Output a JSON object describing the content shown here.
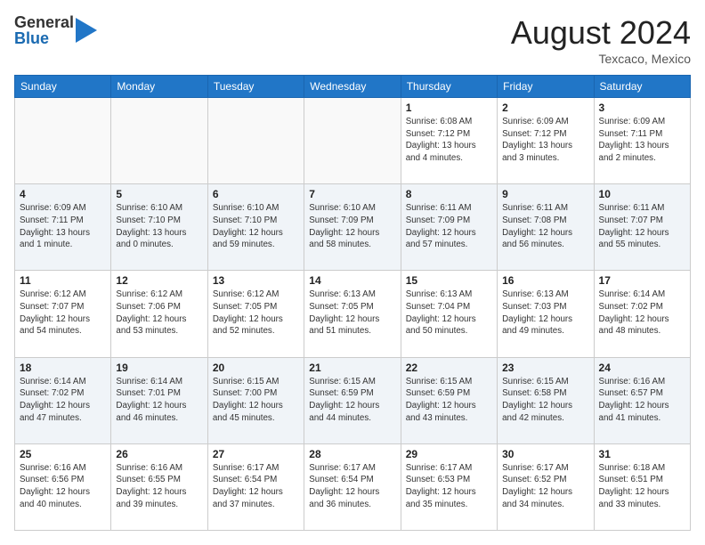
{
  "header": {
    "logo_general": "General",
    "logo_blue": "Blue",
    "month_year": "August 2024",
    "location": "Texcaco, Mexico"
  },
  "weekdays": [
    "Sunday",
    "Monday",
    "Tuesday",
    "Wednesday",
    "Thursday",
    "Friday",
    "Saturday"
  ],
  "weeks": [
    [
      {
        "day": "",
        "info": ""
      },
      {
        "day": "",
        "info": ""
      },
      {
        "day": "",
        "info": ""
      },
      {
        "day": "",
        "info": ""
      },
      {
        "day": "1",
        "info": "Sunrise: 6:08 AM\nSunset: 7:12 PM\nDaylight: 13 hours\nand 4 minutes."
      },
      {
        "day": "2",
        "info": "Sunrise: 6:09 AM\nSunset: 7:12 PM\nDaylight: 13 hours\nand 3 minutes."
      },
      {
        "day": "3",
        "info": "Sunrise: 6:09 AM\nSunset: 7:11 PM\nDaylight: 13 hours\nand 2 minutes."
      }
    ],
    [
      {
        "day": "4",
        "info": "Sunrise: 6:09 AM\nSunset: 7:11 PM\nDaylight: 13 hours\nand 1 minute."
      },
      {
        "day": "5",
        "info": "Sunrise: 6:10 AM\nSunset: 7:10 PM\nDaylight: 13 hours\nand 0 minutes."
      },
      {
        "day": "6",
        "info": "Sunrise: 6:10 AM\nSunset: 7:10 PM\nDaylight: 12 hours\nand 59 minutes."
      },
      {
        "day": "7",
        "info": "Sunrise: 6:10 AM\nSunset: 7:09 PM\nDaylight: 12 hours\nand 58 minutes."
      },
      {
        "day": "8",
        "info": "Sunrise: 6:11 AM\nSunset: 7:09 PM\nDaylight: 12 hours\nand 57 minutes."
      },
      {
        "day": "9",
        "info": "Sunrise: 6:11 AM\nSunset: 7:08 PM\nDaylight: 12 hours\nand 56 minutes."
      },
      {
        "day": "10",
        "info": "Sunrise: 6:11 AM\nSunset: 7:07 PM\nDaylight: 12 hours\nand 55 minutes."
      }
    ],
    [
      {
        "day": "11",
        "info": "Sunrise: 6:12 AM\nSunset: 7:07 PM\nDaylight: 12 hours\nand 54 minutes."
      },
      {
        "day": "12",
        "info": "Sunrise: 6:12 AM\nSunset: 7:06 PM\nDaylight: 12 hours\nand 53 minutes."
      },
      {
        "day": "13",
        "info": "Sunrise: 6:12 AM\nSunset: 7:05 PM\nDaylight: 12 hours\nand 52 minutes."
      },
      {
        "day": "14",
        "info": "Sunrise: 6:13 AM\nSunset: 7:05 PM\nDaylight: 12 hours\nand 51 minutes."
      },
      {
        "day": "15",
        "info": "Sunrise: 6:13 AM\nSunset: 7:04 PM\nDaylight: 12 hours\nand 50 minutes."
      },
      {
        "day": "16",
        "info": "Sunrise: 6:13 AM\nSunset: 7:03 PM\nDaylight: 12 hours\nand 49 minutes."
      },
      {
        "day": "17",
        "info": "Sunrise: 6:14 AM\nSunset: 7:02 PM\nDaylight: 12 hours\nand 48 minutes."
      }
    ],
    [
      {
        "day": "18",
        "info": "Sunrise: 6:14 AM\nSunset: 7:02 PM\nDaylight: 12 hours\nand 47 minutes."
      },
      {
        "day": "19",
        "info": "Sunrise: 6:14 AM\nSunset: 7:01 PM\nDaylight: 12 hours\nand 46 minutes."
      },
      {
        "day": "20",
        "info": "Sunrise: 6:15 AM\nSunset: 7:00 PM\nDaylight: 12 hours\nand 45 minutes."
      },
      {
        "day": "21",
        "info": "Sunrise: 6:15 AM\nSunset: 6:59 PM\nDaylight: 12 hours\nand 44 minutes."
      },
      {
        "day": "22",
        "info": "Sunrise: 6:15 AM\nSunset: 6:59 PM\nDaylight: 12 hours\nand 43 minutes."
      },
      {
        "day": "23",
        "info": "Sunrise: 6:15 AM\nSunset: 6:58 PM\nDaylight: 12 hours\nand 42 minutes."
      },
      {
        "day": "24",
        "info": "Sunrise: 6:16 AM\nSunset: 6:57 PM\nDaylight: 12 hours\nand 41 minutes."
      }
    ],
    [
      {
        "day": "25",
        "info": "Sunrise: 6:16 AM\nSunset: 6:56 PM\nDaylight: 12 hours\nand 40 minutes."
      },
      {
        "day": "26",
        "info": "Sunrise: 6:16 AM\nSunset: 6:55 PM\nDaylight: 12 hours\nand 39 minutes."
      },
      {
        "day": "27",
        "info": "Sunrise: 6:17 AM\nSunset: 6:54 PM\nDaylight: 12 hours\nand 37 minutes."
      },
      {
        "day": "28",
        "info": "Sunrise: 6:17 AM\nSunset: 6:54 PM\nDaylight: 12 hours\nand 36 minutes."
      },
      {
        "day": "29",
        "info": "Sunrise: 6:17 AM\nSunset: 6:53 PM\nDaylight: 12 hours\nand 35 minutes."
      },
      {
        "day": "30",
        "info": "Sunrise: 6:17 AM\nSunset: 6:52 PM\nDaylight: 12 hours\nand 34 minutes."
      },
      {
        "day": "31",
        "info": "Sunrise: 6:18 AM\nSunset: 6:51 PM\nDaylight: 12 hours\nand 33 minutes."
      }
    ]
  ]
}
